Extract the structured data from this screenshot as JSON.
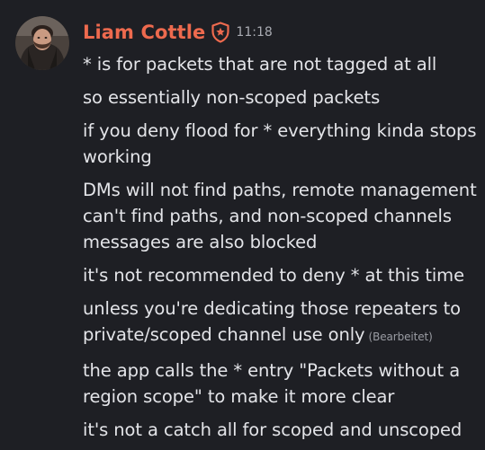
{
  "author": {
    "name": "Liam Cottle",
    "role_icon": "shield-star-icon",
    "name_color": "#ee6a4e"
  },
  "timestamp": "11:18",
  "lines": [
    "* is for packets that are not tagged at all",
    "so essentially non-scoped packets",
    "if you deny flood for * everything kinda stops working",
    "DMs will not find paths, remote management can't find paths, and non-scoped channels messages are also blocked",
    "it's not recommended to deny * at this time",
    "unless you're dedicating those repeaters to private/scoped channel use only",
    "the app calls the * entry \"Packets without a region scope\" to make it more clear",
    "it's not a catch all for scoped and unscoped"
  ],
  "edited_label": "(Bearbeitet)"
}
